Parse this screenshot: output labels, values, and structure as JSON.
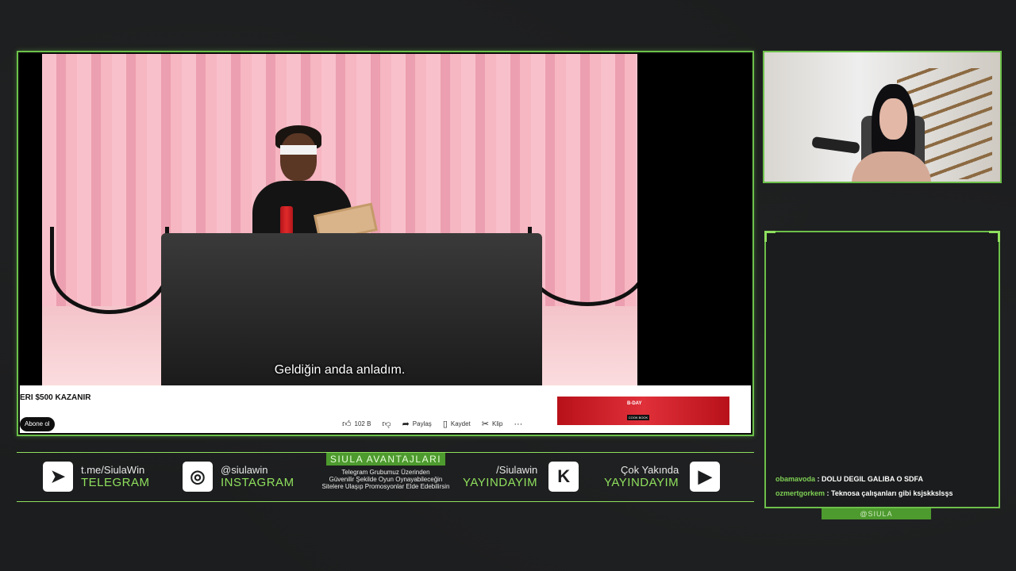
{
  "video": {
    "subtitle": "Geldiğin anda anladım.",
    "title": "ERI $500 KAZANIR",
    "subscribe_label": "Abone ol",
    "actions": [
      {
        "icon": "thumbs-up-icon",
        "label": "102 B"
      },
      {
        "icon": "thumbs-down-icon",
        "label": ""
      },
      {
        "icon": "share-icon",
        "label": "Paylaş"
      },
      {
        "icon": "bookmark-icon",
        "label": "Kaydet"
      },
      {
        "icon": "scissors-icon",
        "label": "Klip"
      },
      {
        "icon": "more-icon",
        "label": "···"
      }
    ],
    "ad": {
      "text": "B-DAY",
      "button": "COOK BOOK"
    }
  },
  "chat": {
    "messages": [
      {
        "user": "obamavoda",
        "text": ": DOLU DEGIL GALIBA O SDFA"
      },
      {
        "user": "ozmertgorkem",
        "text": ": Teknosa çalışanları gibi ksjskksIsşs"
      }
    ],
    "tag": "@SIULA"
  },
  "bar": {
    "telegram": {
      "small": "t.me/SiulaWin",
      "big": "TELEGRAM"
    },
    "instagram": {
      "small": "@siulawin",
      "big": "INSTAGRAM"
    },
    "center": {
      "title": "SIULA AVANTAJLARI",
      "line1": "Telegram Grubumuz Üzerinden",
      "line2": "Güvenilir Şekilde Oyun Oynayabileceğin",
      "line3": "Sitelere Ulaşıp Promosyonlar Elde Edebilirsin"
    },
    "kick": {
      "small": "/Siulawin",
      "big": "YAYINDAYIM"
    },
    "youtube": {
      "small": "Çok Yakında",
      "big": "YAYINDAYIM"
    }
  },
  "colors": {
    "accent": "#6cc04a",
    "background": "#1c1d1e",
    "tag_bg": "#4d9a2e"
  }
}
